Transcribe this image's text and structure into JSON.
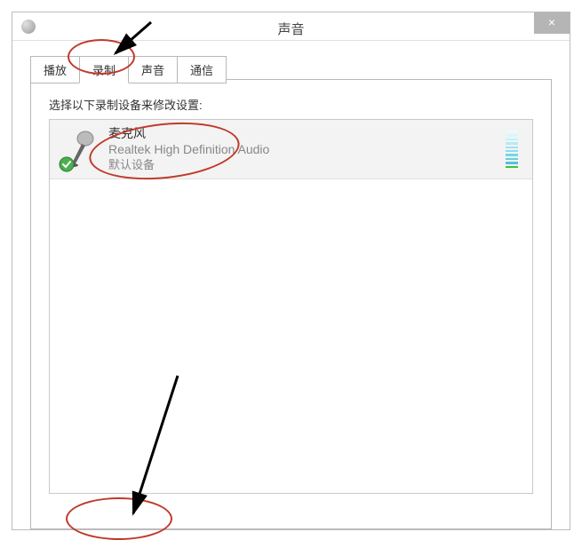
{
  "window": {
    "title": "声音",
    "close_symbol": "×"
  },
  "tabs": [
    {
      "label": "播放",
      "active": false
    },
    {
      "label": "录制",
      "active": true
    },
    {
      "label": "声音",
      "active": false
    },
    {
      "label": "通信",
      "active": false
    }
  ],
  "instruction": "选择以下录制设备来修改设置:",
  "devices": [
    {
      "name": "麦克风",
      "description": "Realtek High Definition Audio",
      "status": "默认设备",
      "is_default": true,
      "level_bars": [
        {
          "color": "#40c040"
        },
        {
          "color": "#4fc6d6"
        },
        {
          "color": "#62cfe0"
        },
        {
          "color": "#76d6e6"
        },
        {
          "color": "#8adeec"
        },
        {
          "color": "#9de5f1"
        },
        {
          "color": "#b1ecf6"
        },
        {
          "color": "#c3f2fa"
        },
        {
          "color": "#d6f8fd"
        },
        {
          "color": "#e8fdff"
        }
      ]
    }
  ]
}
